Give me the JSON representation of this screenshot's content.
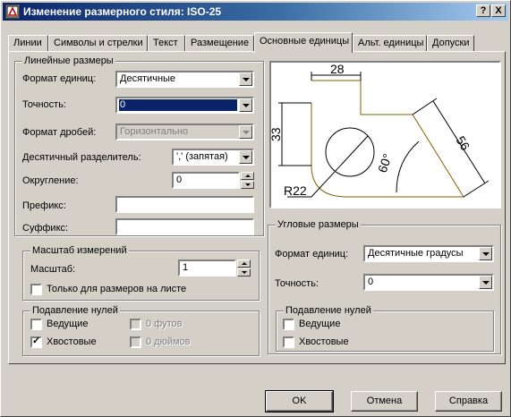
{
  "window": {
    "title": "Изменение размерного стиля: ISO-25",
    "help_btn": "?",
    "close_btn": "X"
  },
  "tabs": [
    {
      "label": "Линии"
    },
    {
      "label": "Символы и стрелки"
    },
    {
      "label": "Текст"
    },
    {
      "label": "Размещение"
    },
    {
      "label": "Основные единицы",
      "active": true
    },
    {
      "label": "Альт. единицы"
    },
    {
      "label": "Допуски"
    }
  ],
  "linear": {
    "title": "Линейные размеры",
    "unit_format_label": "Формат единиц:",
    "unit_format_value": "Десятичные",
    "precision_label": "Точность:",
    "precision_value": "0",
    "fraction_label": "Формат дробей:",
    "fraction_value": "Горизонтально",
    "decimal_sep_label": "Десятичный  разделитель:",
    "decimal_sep_value": "',' (запятая)",
    "rounding_label": "Округление:",
    "rounding_value": "0",
    "prefix_label": "Префикс:",
    "prefix_value": "",
    "suffix_label": "Суффикс:",
    "suffix_value": ""
  },
  "scale": {
    "title": "Масштаб измерений",
    "scale_label": "Масштаб:",
    "scale_value": "1",
    "layout_only_label": "Только для размеров на листе",
    "layout_only_checked": false
  },
  "zero_linear": {
    "title": "Подавление нулей",
    "leading_label": "Ведущие",
    "leading_checked": false,
    "trailing_label": "Хвостовые",
    "trailing_checked": true,
    "feet_label": "0 футов",
    "inches_label": "0 дюймов"
  },
  "preview": {
    "dim_top": "28",
    "dim_left": "33",
    "dim_slant": "56",
    "dim_angle": "60°",
    "dim_radius": "R22"
  },
  "angular": {
    "title": "Угловые размеры",
    "unit_format_label": "Формат единиц:",
    "unit_format_value": "Десятичные градусы",
    "precision_label": "Точность:",
    "precision_value": "0"
  },
  "zero_angular": {
    "title": "Подавление нулей",
    "leading_label": "Ведущие",
    "leading_checked": false,
    "trailing_label": "Хвостовые",
    "trailing_checked": false
  },
  "buttons": {
    "ok": "OK",
    "cancel": "Отмена",
    "help": "Справка"
  },
  "colors": {
    "titlebar_start": "#0a246a",
    "titlebar_end": "#a6caf0",
    "face": "#d4d0c8",
    "selection": "#0a246a",
    "preview_outline": "#806000"
  }
}
